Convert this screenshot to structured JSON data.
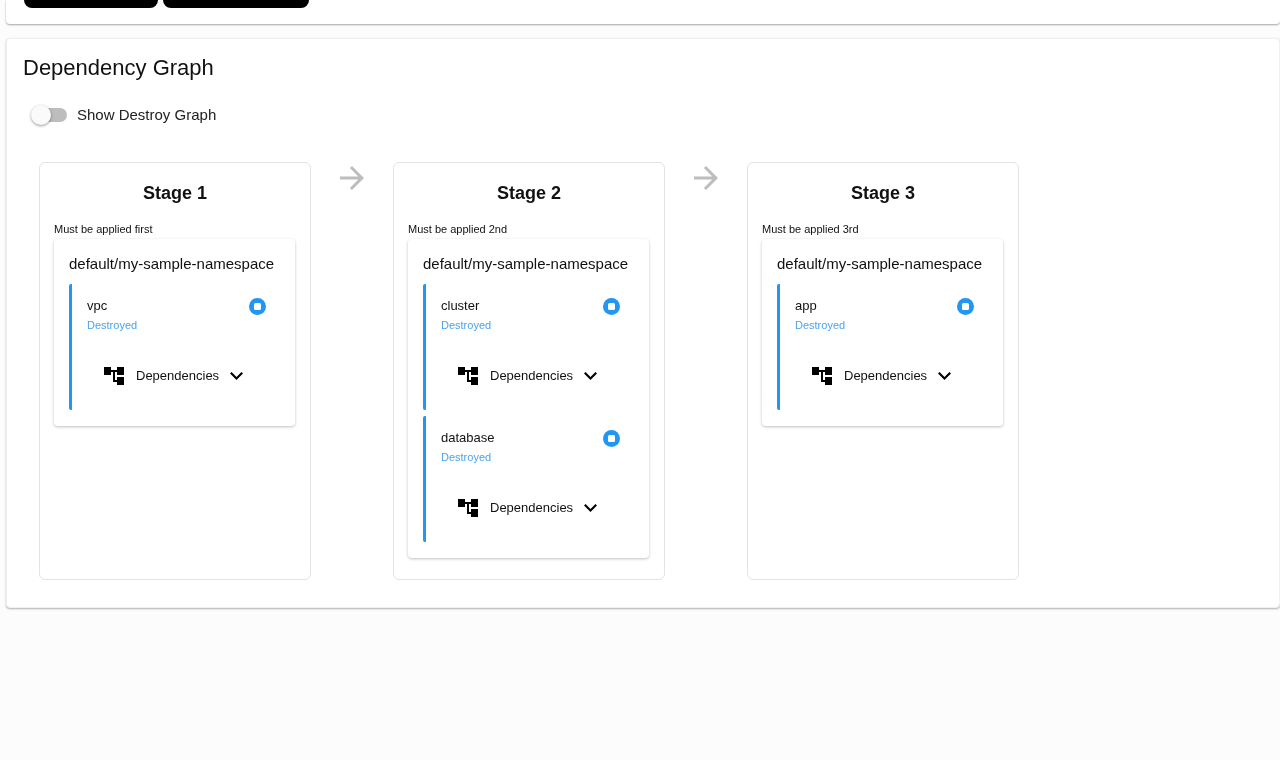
{
  "graph": {
    "title": "Dependency Graph",
    "toggle": {
      "label": "Show Destroy Graph",
      "on": false
    },
    "stages": [
      {
        "title": "Stage 1",
        "subtitle": "Must be applied first",
        "groups": [
          {
            "namespace": "default/my-sample-namespace",
            "resources": [
              {
                "name": "vpc",
                "status": "Destroyed",
                "dependencies_label": "Dependencies",
                "expanded": false
              }
            ]
          }
        ]
      },
      {
        "title": "Stage 2",
        "subtitle": "Must be applied 2nd",
        "groups": [
          {
            "namespace": "default/my-sample-namespace",
            "resources": [
              {
                "name": "cluster",
                "status": "Destroyed",
                "dependencies_label": "Dependencies",
                "expanded": false
              },
              {
                "name": "database",
                "status": "Destroyed",
                "dependencies_label": "Dependencies",
                "expanded": false
              }
            ]
          }
        ]
      },
      {
        "title": "Stage 3",
        "subtitle": "Must be applied 3rd",
        "groups": [
          {
            "namespace": "default/my-sample-namespace",
            "resources": [
              {
                "name": "app",
                "status": "Destroyed",
                "dependencies_label": "Dependencies",
                "expanded": false
              }
            ]
          }
        ]
      }
    ]
  }
}
